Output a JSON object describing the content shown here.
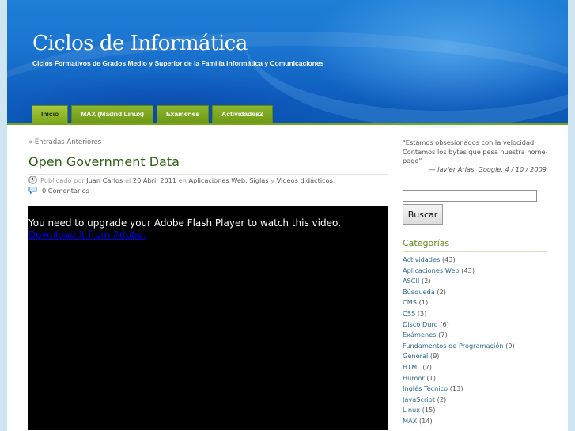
{
  "header": {
    "title": "Ciclos de Informática",
    "description": "Ciclos Formativos de Grados Medio y Superior de la Familia Informática y Comunicaciones"
  },
  "nav": {
    "tabs": [
      {
        "label": "Inicio"
      },
      {
        "label": "MAX (Madrid Linux)"
      },
      {
        "label": "Exámenes"
      },
      {
        "label": "Actividades2"
      }
    ]
  },
  "content": {
    "prev_link": "« Entradas Anteriores",
    "post": {
      "title": "Open Government Data",
      "meta_prefix": "Publicado por",
      "author": "Juan Carlos",
      "date_prefix": "el",
      "date": "20 Abril 2011",
      "in_word": "en",
      "category1": "Aplicaciones Web",
      "sep_comma": ",",
      "category2": "Siglas",
      "and_word": "y",
      "category3": "Videos didácticos",
      "end_dot": ".",
      "comments": "0 Comentarios"
    },
    "video": {
      "message": "You need to upgrade your Adobe Flash Player to watch this video.",
      "download_link": "Download it from Adobe."
    }
  },
  "sidebar": {
    "quote": "\"Estamos obsesionados con la velocidad. Contamos los bytes que pesa nuestra home-page\"",
    "quote_author": "— Javier Arias, Google, 4 / 10 / 2009",
    "search_value": "",
    "search_button": "Buscar",
    "categories_title": "Categorías",
    "categories": [
      {
        "name": "Actividades",
        "count": "(43)"
      },
      {
        "name": "Aplicaciones Web",
        "count": "(43)"
      },
      {
        "name": "ASCII",
        "count": "(2)"
      },
      {
        "name": "Búsqueda",
        "count": "(2)"
      },
      {
        "name": "CMS",
        "count": "(1)"
      },
      {
        "name": "CSS",
        "count": "(3)"
      },
      {
        "name": "Disco Duro",
        "count": "(6)"
      },
      {
        "name": "Exámenes",
        "count": "(7)"
      },
      {
        "name": "Fundamentos de Programación",
        "count": "(9)"
      },
      {
        "name": "General",
        "count": "(9)"
      },
      {
        "name": "HTML",
        "count": "(7)"
      },
      {
        "name": "Humor",
        "count": "(1)"
      },
      {
        "name": "Inglés Técnico",
        "count": "(13)"
      },
      {
        "name": "JavaScript",
        "count": "(2)"
      },
      {
        "name": "Linux",
        "count": "(15)"
      },
      {
        "name": "MAX",
        "count": "(14)"
      }
    ]
  },
  "icons": {
    "clock": "clock-icon",
    "comment": "comment-bubble-icon"
  }
}
